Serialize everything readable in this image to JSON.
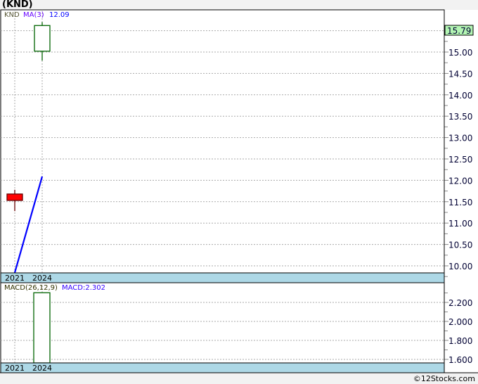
{
  "title": "(KND)",
  "credit": "©12Stocks.com",
  "chart_data": [
    {
      "type": "candlestick",
      "ticker_label": "KND",
      "ma_label": "MA(3)",
      "ma_value_label": "12.09",
      "last_price_label": "15.79",
      "categories": [
        "2021",
        "2024"
      ],
      "candles": [
        {
          "x": "2021",
          "open": 11.68,
          "high": 11.78,
          "low": 11.28,
          "close": 11.53
        },
        {
          "x": "2024",
          "open": 15.02,
          "high": 15.7,
          "low": 14.8,
          "close": 15.62
        }
      ],
      "ma_series": [
        {
          "x": "2021",
          "y": 9.84
        },
        {
          "x": "2024",
          "y": 12.09
        }
      ],
      "ylim": [
        9.84,
        15.99
      ],
      "yticks": [
        "10.00",
        "10.50",
        "11.00",
        "11.50",
        "12.00",
        "12.50",
        "13.00",
        "13.50",
        "14.00",
        "14.50",
        "15.00",
        "15.50"
      ],
      "grid": true,
      "colors": {
        "down": "#ff0000",
        "up": "#006400",
        "ma": "#0000ff",
        "axis_band": "#add8e6",
        "price_tag": "#b3f5b3"
      }
    },
    {
      "type": "bar",
      "label": "MACD(26,12,9)",
      "value_label": "MACD:2.302",
      "categories": [
        "2021",
        "2024"
      ],
      "values": [
        null,
        2.302
      ],
      "ylim": [
        1.55,
        2.41
      ],
      "yticks": [
        "1.600",
        "1.800",
        "2.000",
        "2.200"
      ],
      "grid": true
    }
  ]
}
